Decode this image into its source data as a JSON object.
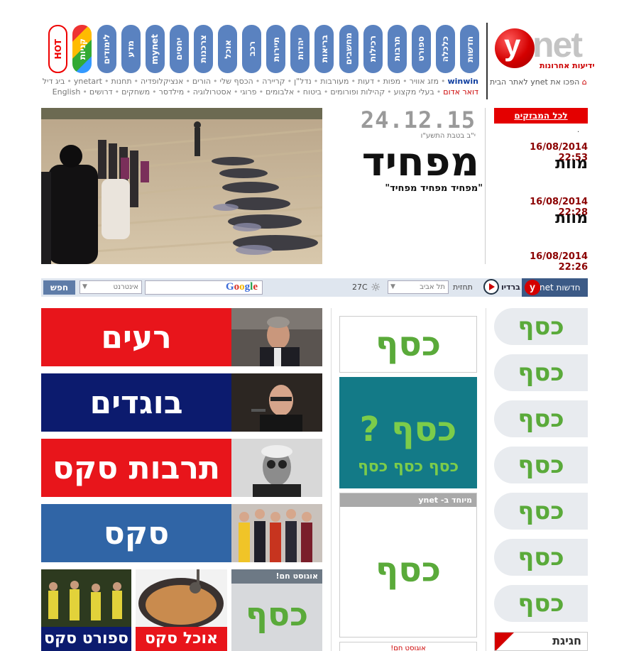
{
  "logo": {
    "letter": "y",
    "net": "net",
    "subtitle": "ידיעות אחרונות"
  },
  "home_link": "הפכו את ynet לאתר הבית",
  "nav": {
    "pills": [
      "חדשות",
      "כלכלה",
      "ספורט",
      "תרבות",
      "רכילות",
      "מחשבים",
      "בריאות",
      "יהדות",
      "תיירות",
      "רכב",
      "אוכל",
      "צרכנות",
      "יחסים",
      "mynet",
      "מדע",
      "לימודים",
      "קניות",
      "HOT"
    ],
    "row1": [
      "winwin",
      "מזג אוויר",
      "מפות",
      "דעות",
      "מעורבות",
      "נדל\"ן",
      "קריירה",
      "הכסף שלי",
      "הורים",
      "אנציקלופדיה",
      "תחנות",
      "ynetart",
      "ביג דיל"
    ],
    "row2": [
      "דואר אדום",
      "בעלי מקצוע",
      "קהילות ופורומים",
      "ביטוח",
      "אלבומים",
      "פרוגי",
      "אסטרולוגיה",
      "מילדסר",
      "משחקים",
      "דרושים",
      "English"
    ]
  },
  "ticker": {
    "header": "לכל המבזקים",
    "items": [
      {
        "time": "16/08/2014 22:53",
        "title": "מוות"
      },
      {
        "time": "16/08/2014 22:28",
        "title": "מוות"
      },
      {
        "time": "16/08/2014 22:26",
        "title": ""
      }
    ]
  },
  "main_story": {
    "date": "24.12.15",
    "hebrew_date": "י\"ב בטבת התשע\"ו",
    "headline": "מפחיד",
    "subheadline": "\"מפחיד מפחיד מפחיד\""
  },
  "toolbar": {
    "search_button": "חפש",
    "search_scope": "אינטרנט",
    "google": [
      "G",
      "o",
      "o",
      "g",
      "l",
      "e"
    ],
    "google_colors": [
      "#3b6bd8",
      "#d93025",
      "#f2b400",
      "#3b6bd8",
      "#1e9e4a",
      "#d93025"
    ],
    "temperature": "27C",
    "city": "תל אביב",
    "forecast": "תחזית",
    "radio_label": "ברדיו",
    "radio_text": "חדשות net"
  },
  "banners": [
    {
      "text": "רעים",
      "color": "#e8151b"
    },
    {
      "text": "בוגדים",
      "color": "#0c1b6e"
    },
    {
      "text": "תרבות סקס",
      "color": "#e8151b"
    },
    {
      "text": "סקס",
      "color": "#3065a6"
    }
  ],
  "tiles": [
    {
      "label": "ספורט סקס",
      "color": "#0c1b6e"
    },
    {
      "label": "אוכל סקס",
      "color": "#e8151b"
    }
  ],
  "august_tile": {
    "header": "אוגוסט חם!",
    "word": "כסף"
  },
  "center": {
    "ad1": "כסף",
    "ad2_big": "כסף ?",
    "ad2_small": "כסף כסף כסף",
    "special_header": "מיוחד ב- ynet",
    "ad3": "כסף",
    "bottom_header": "אוגוסט חם!"
  },
  "right_pills": [
    "כסף",
    "כסף",
    "כסף",
    "כסף",
    "כסף",
    "כסף",
    "כסף"
  ],
  "corner_label": "חגיגת"
}
